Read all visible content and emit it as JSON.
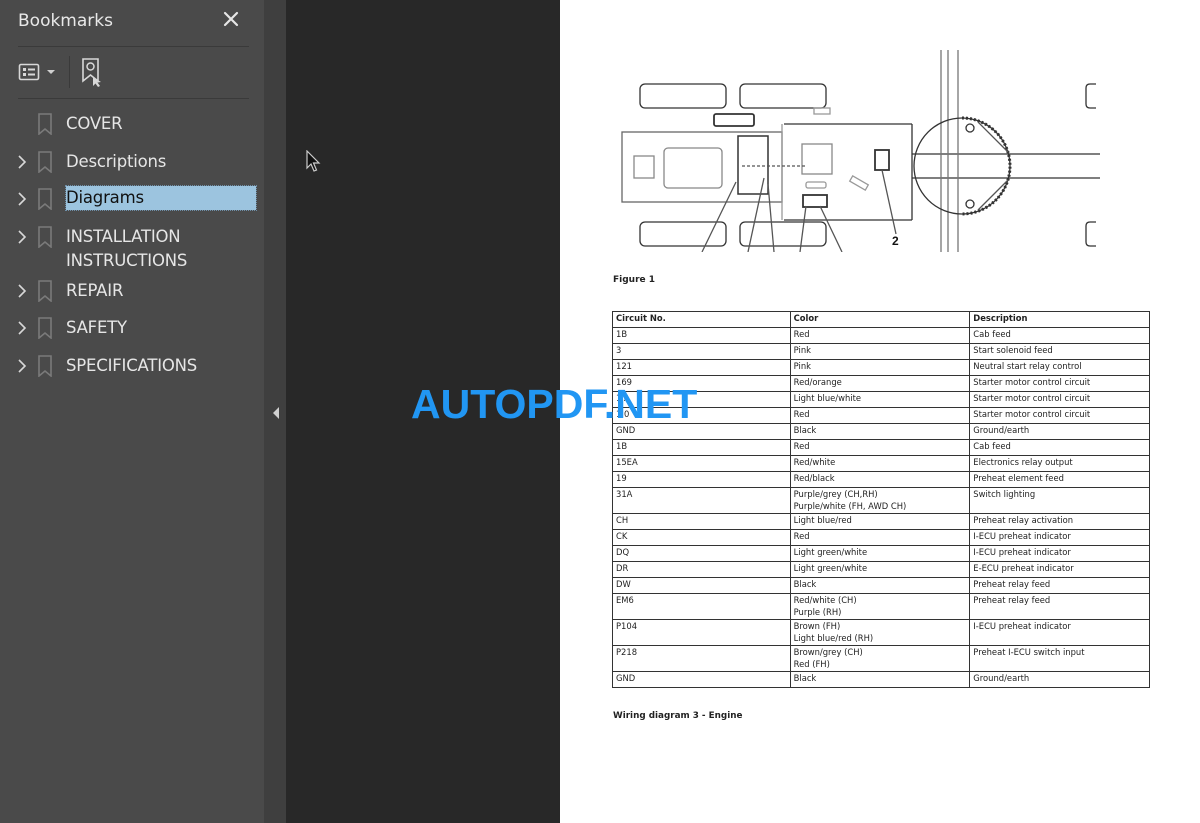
{
  "sidebar": {
    "title": "Bookmarks",
    "close_icon": "close-icon",
    "tools": {
      "options_icon": "list-options-icon",
      "options_dropdown_icon": "chevron-down-icon",
      "find_bookmark_icon": "find-current-bookmark-icon"
    },
    "items": [
      {
        "label": "COVER",
        "expandable": false,
        "selected": false
      },
      {
        "label": "Descriptions",
        "expandable": true,
        "selected": false
      },
      {
        "label": "Diagrams",
        "expandable": true,
        "selected": true
      },
      {
        "label": "INSTALLATION INSTRUCTIONS",
        "label_lines": [
          "INSTALLATION",
          "INSTRUCTIONS"
        ],
        "expandable": true,
        "selected": false
      },
      {
        "label": "REPAIR",
        "expandable": true,
        "selected": false
      },
      {
        "label": "SAFETY",
        "expandable": true,
        "selected": false
      },
      {
        "label": "SPECIFICATIONS",
        "expandable": true,
        "selected": false
      }
    ],
    "selection_color": "#9cc4df"
  },
  "splitter": {
    "collapse_icon": "collapse-left-icon"
  },
  "document": {
    "figure": {
      "callout_label": "2",
      "caption": "Figure 1"
    },
    "table": {
      "headers": [
        "Circuit No.",
        "Color",
        "Description"
      ],
      "rows": [
        {
          "circuit": "1B",
          "color": [
            "Red"
          ],
          "description": "Cab feed"
        },
        {
          "circuit": "3",
          "color": [
            "Pink"
          ],
          "description": "Start solenoid feed"
        },
        {
          "circuit": "121",
          "color": [
            "Pink"
          ],
          "description": "Neutral start relay control"
        },
        {
          "circuit": "169",
          "color": [
            "Red/orange"
          ],
          "description": "Starter motor control circuit"
        },
        {
          "circuit": "1  A",
          "color": [
            "Light blue/white"
          ],
          "description": "Starter motor control circuit"
        },
        {
          "circuit": "1  0",
          "color": [
            "Red"
          ],
          "description": "Starter motor control circuit"
        },
        {
          "circuit": "GND",
          "color": [
            "Black"
          ],
          "description": "Ground/earth"
        },
        {
          "circuit": "1B",
          "color": [
            "Red"
          ],
          "description": "Cab feed"
        },
        {
          "circuit": "15EA",
          "color": [
            "Red/white"
          ],
          "description": "Electronics relay output"
        },
        {
          "circuit": "19",
          "color": [
            "Red/black"
          ],
          "description": "Preheat element feed"
        },
        {
          "circuit": "31A",
          "color": [
            "Purple/grey (CH,RH)",
            "Purple/white (FH, AWD CH)"
          ],
          "description": "Switch lighting"
        },
        {
          "circuit": "CH",
          "color": [
            "Light blue/red"
          ],
          "description": "Preheat relay activation"
        },
        {
          "circuit": "CK",
          "color": [
            "Red"
          ],
          "description": "I-ECU preheat indicator"
        },
        {
          "circuit": "DQ",
          "color": [
            "Light green/white"
          ],
          "description": "I-ECU preheat indicator"
        },
        {
          "circuit": "DR",
          "color": [
            "Light green/white"
          ],
          "description": "E-ECU preheat indicator"
        },
        {
          "circuit": "DW",
          "color": [
            "Black"
          ],
          "description": "Preheat relay feed"
        },
        {
          "circuit": "EM6",
          "color": [
            "Red/white (CH)",
            "Purple (RH)"
          ],
          "description": "Preheat relay feed"
        },
        {
          "circuit": "P104",
          "color": [
            "Brown (FH)",
            "Light blue/red (RH)"
          ],
          "description": "I-ECU preheat indicator"
        },
        {
          "circuit": "P218",
          "color": [
            "Brown/grey (CH)",
            "Red (FH)"
          ],
          "description": "Preheat I-ECU switch input"
        },
        {
          "circuit": "GND",
          "color": [
            "Black"
          ],
          "description": "Ground/earth"
        }
      ],
      "caption": "Wiring diagram 3 - Engine"
    }
  },
  "watermark": {
    "text": "AUTOPDF.NET",
    "color": "#2196f3"
  }
}
